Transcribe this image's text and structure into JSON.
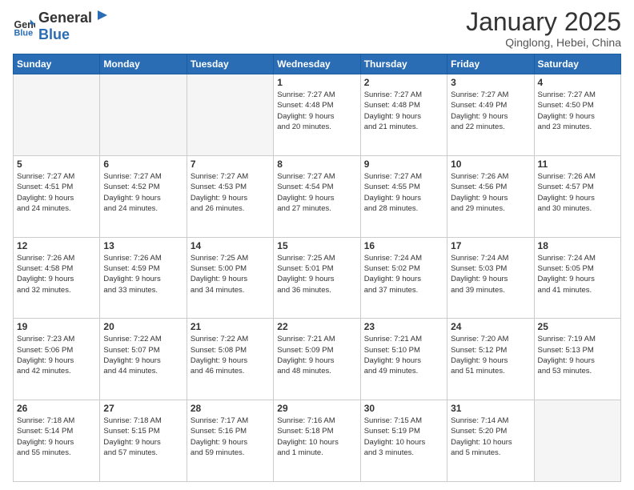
{
  "logo": {
    "general": "General",
    "blue": "Blue"
  },
  "header": {
    "month": "January 2025",
    "location": "Qinglong, Hebei, China"
  },
  "weekdays": [
    "Sunday",
    "Monday",
    "Tuesday",
    "Wednesday",
    "Thursday",
    "Friday",
    "Saturday"
  ],
  "weeks": [
    [
      {
        "day": "",
        "info": ""
      },
      {
        "day": "",
        "info": ""
      },
      {
        "day": "",
        "info": ""
      },
      {
        "day": "1",
        "info": "Sunrise: 7:27 AM\nSunset: 4:48 PM\nDaylight: 9 hours\nand 20 minutes."
      },
      {
        "day": "2",
        "info": "Sunrise: 7:27 AM\nSunset: 4:48 PM\nDaylight: 9 hours\nand 21 minutes."
      },
      {
        "day": "3",
        "info": "Sunrise: 7:27 AM\nSunset: 4:49 PM\nDaylight: 9 hours\nand 22 minutes."
      },
      {
        "day": "4",
        "info": "Sunrise: 7:27 AM\nSunset: 4:50 PM\nDaylight: 9 hours\nand 23 minutes."
      }
    ],
    [
      {
        "day": "5",
        "info": "Sunrise: 7:27 AM\nSunset: 4:51 PM\nDaylight: 9 hours\nand 24 minutes."
      },
      {
        "day": "6",
        "info": "Sunrise: 7:27 AM\nSunset: 4:52 PM\nDaylight: 9 hours\nand 24 minutes."
      },
      {
        "day": "7",
        "info": "Sunrise: 7:27 AM\nSunset: 4:53 PM\nDaylight: 9 hours\nand 26 minutes."
      },
      {
        "day": "8",
        "info": "Sunrise: 7:27 AM\nSunset: 4:54 PM\nDaylight: 9 hours\nand 27 minutes."
      },
      {
        "day": "9",
        "info": "Sunrise: 7:27 AM\nSunset: 4:55 PM\nDaylight: 9 hours\nand 28 minutes."
      },
      {
        "day": "10",
        "info": "Sunrise: 7:26 AM\nSunset: 4:56 PM\nDaylight: 9 hours\nand 29 minutes."
      },
      {
        "day": "11",
        "info": "Sunrise: 7:26 AM\nSunset: 4:57 PM\nDaylight: 9 hours\nand 30 minutes."
      }
    ],
    [
      {
        "day": "12",
        "info": "Sunrise: 7:26 AM\nSunset: 4:58 PM\nDaylight: 9 hours\nand 32 minutes."
      },
      {
        "day": "13",
        "info": "Sunrise: 7:26 AM\nSunset: 4:59 PM\nDaylight: 9 hours\nand 33 minutes."
      },
      {
        "day": "14",
        "info": "Sunrise: 7:25 AM\nSunset: 5:00 PM\nDaylight: 9 hours\nand 34 minutes."
      },
      {
        "day": "15",
        "info": "Sunrise: 7:25 AM\nSunset: 5:01 PM\nDaylight: 9 hours\nand 36 minutes."
      },
      {
        "day": "16",
        "info": "Sunrise: 7:24 AM\nSunset: 5:02 PM\nDaylight: 9 hours\nand 37 minutes."
      },
      {
        "day": "17",
        "info": "Sunrise: 7:24 AM\nSunset: 5:03 PM\nDaylight: 9 hours\nand 39 minutes."
      },
      {
        "day": "18",
        "info": "Sunrise: 7:24 AM\nSunset: 5:05 PM\nDaylight: 9 hours\nand 41 minutes."
      }
    ],
    [
      {
        "day": "19",
        "info": "Sunrise: 7:23 AM\nSunset: 5:06 PM\nDaylight: 9 hours\nand 42 minutes."
      },
      {
        "day": "20",
        "info": "Sunrise: 7:22 AM\nSunset: 5:07 PM\nDaylight: 9 hours\nand 44 minutes."
      },
      {
        "day": "21",
        "info": "Sunrise: 7:22 AM\nSunset: 5:08 PM\nDaylight: 9 hours\nand 46 minutes."
      },
      {
        "day": "22",
        "info": "Sunrise: 7:21 AM\nSunset: 5:09 PM\nDaylight: 9 hours\nand 48 minutes."
      },
      {
        "day": "23",
        "info": "Sunrise: 7:21 AM\nSunset: 5:10 PM\nDaylight: 9 hours\nand 49 minutes."
      },
      {
        "day": "24",
        "info": "Sunrise: 7:20 AM\nSunset: 5:12 PM\nDaylight: 9 hours\nand 51 minutes."
      },
      {
        "day": "25",
        "info": "Sunrise: 7:19 AM\nSunset: 5:13 PM\nDaylight: 9 hours\nand 53 minutes."
      }
    ],
    [
      {
        "day": "26",
        "info": "Sunrise: 7:18 AM\nSunset: 5:14 PM\nDaylight: 9 hours\nand 55 minutes."
      },
      {
        "day": "27",
        "info": "Sunrise: 7:18 AM\nSunset: 5:15 PM\nDaylight: 9 hours\nand 57 minutes."
      },
      {
        "day": "28",
        "info": "Sunrise: 7:17 AM\nSunset: 5:16 PM\nDaylight: 9 hours\nand 59 minutes."
      },
      {
        "day": "29",
        "info": "Sunrise: 7:16 AM\nSunset: 5:18 PM\nDaylight: 10 hours\nand 1 minute."
      },
      {
        "day": "30",
        "info": "Sunrise: 7:15 AM\nSunset: 5:19 PM\nDaylight: 10 hours\nand 3 minutes."
      },
      {
        "day": "31",
        "info": "Sunrise: 7:14 AM\nSunset: 5:20 PM\nDaylight: 10 hours\nand 5 minutes."
      },
      {
        "day": "",
        "info": ""
      }
    ]
  ]
}
